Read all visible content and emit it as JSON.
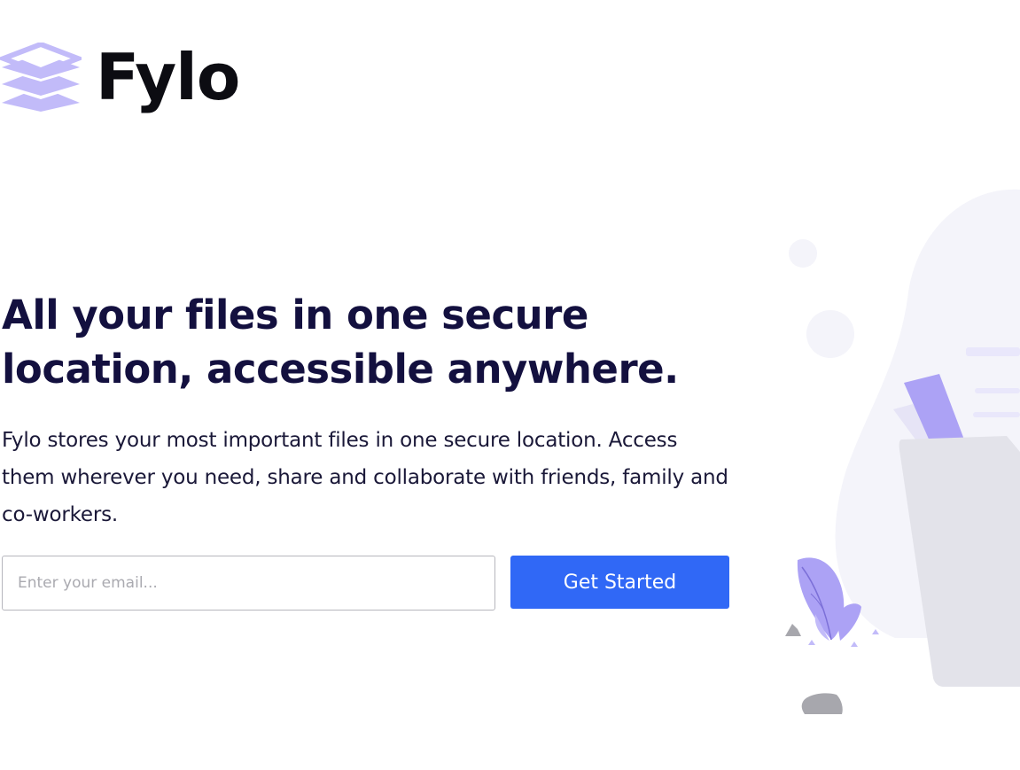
{
  "brand": {
    "name": "Fylo",
    "logo_icon": "stacked-layers-icon",
    "logo_color": "#c2bbf9"
  },
  "hero": {
    "headline": "All your files in one secure location, accessible anywhere.",
    "description": "Fylo stores your most important files in one secure location. Access them wherever you need, share and collaborate with friends, family and co-workers.",
    "illustration": "file-folder-illustration"
  },
  "signup": {
    "email_placeholder": "Enter your email...",
    "email_value": "",
    "button_label": "Get Started",
    "button_color": "#3068f6"
  },
  "colors": {
    "headline": "#13103f",
    "body_text": "#1a1838",
    "accent_purple": "#aca2f5",
    "illustration_gray": "#e3e3ea"
  }
}
